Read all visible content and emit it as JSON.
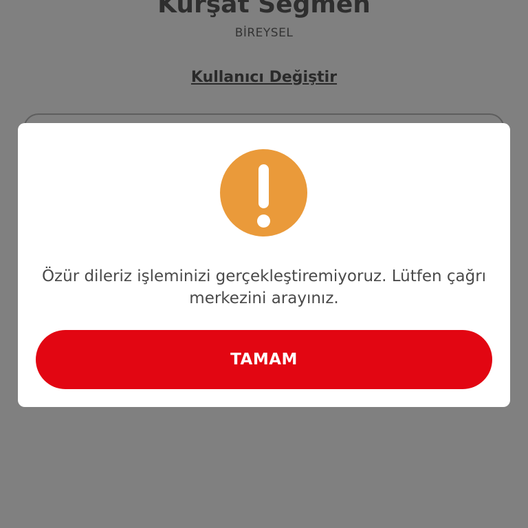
{
  "background": {
    "user_name": "Kürşat Seğmen",
    "user_type": "BİREYSEL",
    "change_user_link": "Kullanıcı Değiştir"
  },
  "dialog": {
    "icon": "exclamation-icon",
    "message": "Özür dileriz işleminizi gerçekleştiremiyoruz. Lütfen çağrı merkezini arayınız.",
    "ok_label": "TAMAM"
  },
  "colors": {
    "overlay": "#808080",
    "dialog_background": "#ffffff",
    "warning_icon": "#ea9a3a",
    "primary_button": "#e20612",
    "message_text": "#4a4a4a"
  }
}
